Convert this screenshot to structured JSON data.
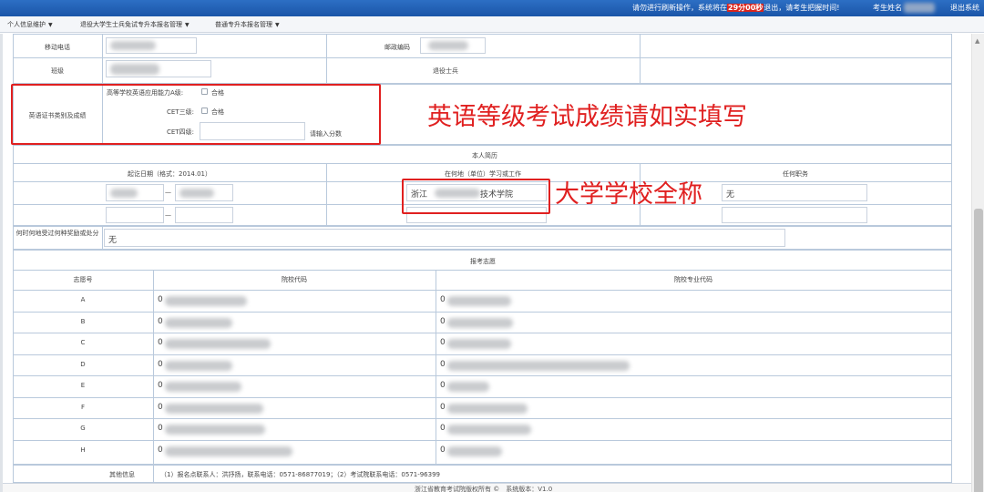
{
  "topbar": {
    "notice_prefix": "请勿进行刷新操作，系统将在",
    "timer": "29分00秒",
    "notice_suffix": "退出，请考生把握时间!",
    "user_label": "考生姓名",
    "logout_label": "退出系统"
  },
  "menu": [
    {
      "label": "个人信息维护"
    },
    {
      "label": "退役大学生士兵免试专升本报名管理"
    },
    {
      "label": "普通专升本报名管理"
    }
  ],
  "info": {
    "mobile_label": "移动电话",
    "postcode_label": "邮政编码",
    "class_label": "班级",
    "veteran_label": "退役士兵"
  },
  "english": {
    "section_label": "英语证书类别及成绩",
    "level_a_label": "高等学校英语应用能力A级:",
    "level_a_option": "合格",
    "cet3_label": "CET三级:",
    "cet3_option": "合格",
    "cet4_label": "CET四级:",
    "cet4_placeholder": "请输入分数"
  },
  "resume": {
    "title": "本人简历",
    "col_date": "起讫日期（格式：2014.01）",
    "col_place": "在何地（单位）学习或工作",
    "col_position": "任何职务",
    "dash": "—",
    "row1_place_prefix": "浙江",
    "row1_place_suffix": "技术学院",
    "row1_position": "无",
    "awards_label": "何时何地受过何种奖励或处分",
    "awards_value": "无"
  },
  "choices": {
    "title": "报考志愿",
    "col_no": "志愿号",
    "col_school_code": "院校代码",
    "col_major_code": "院校专业代码",
    "rows": [
      {
        "no": "A",
        "school_prefix": "0",
        "major_prefix": "0"
      },
      {
        "no": "B",
        "school_prefix": "0",
        "major_prefix": "0"
      },
      {
        "no": "C",
        "school_prefix": "0",
        "major_prefix": "0"
      },
      {
        "no": "D",
        "school_prefix": "0",
        "major_prefix": "0"
      },
      {
        "no": "E",
        "school_prefix": "0",
        "major_prefix": "0"
      },
      {
        "no": "F",
        "school_prefix": "0",
        "major_prefix": "0"
      },
      {
        "no": "G",
        "school_prefix": "0",
        "major_prefix": "0"
      },
      {
        "no": "H",
        "school_prefix": "0",
        "major_prefix": "0"
      }
    ]
  },
  "other_info": {
    "label": "其他信息",
    "text": "（1）报名点联系人：洪抒扬，联系电话：0571-86877019；（2）考试院联系电话：0571-96399"
  },
  "footer": {
    "text": "浙江省教育考试院版权所有 ©　系统版本：V1.0"
  },
  "annotations": {
    "english_note": "英语等级考试成绩请如实填写",
    "school_note": "大学学校全称",
    "color": "#e02020"
  },
  "colors": {
    "topbar": "#1a55a8",
    "timer_bg": "#d9251d",
    "table_border": "#b9c9dc"
  }
}
